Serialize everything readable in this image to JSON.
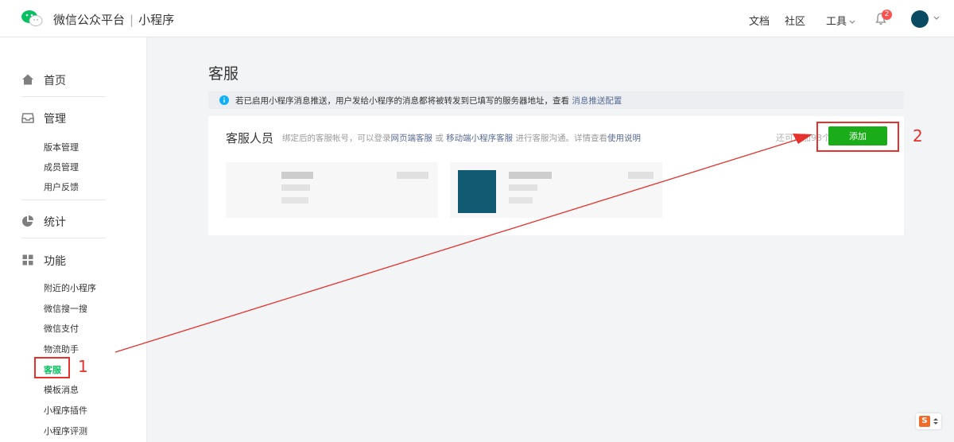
{
  "header": {
    "brand": "微信公众平台",
    "separator": "|",
    "product": "小程序",
    "nav": [
      "文档",
      "社区",
      "工具"
    ],
    "notification_count": "2",
    "tools_caret_icon": "chevron-down-icon",
    "logo_icon": "wechat-logo-icon",
    "bell_icon": "bell-icon"
  },
  "sidebar": {
    "groups": [
      {
        "label": "首页",
        "icon": "home-icon"
      },
      {
        "label": "管理",
        "icon": "inbox-icon",
        "items": [
          "版本管理",
          "成员管理",
          "用户反馈"
        ]
      },
      {
        "label": "统计",
        "icon": "pie-chart-icon"
      },
      {
        "label": "功能",
        "icon": "grid-icon",
        "items": [
          "附近的小程序",
          "微信搜一搜",
          "微信支付",
          "物流助手",
          "客服",
          "模板消息",
          "小程序插件",
          "小程序评测"
        ]
      }
    ],
    "active_item": "客服"
  },
  "main": {
    "title": "客服",
    "notice": {
      "text": "若已启用小程序消息推送，用户发给小程序的消息都将被转发到已填写的服务器地址，查看 ",
      "link": "消息推送配置"
    },
    "card": {
      "title": "客服人员",
      "desc_prefix": "绑定后的客服帐号，可以登录",
      "link_web": "网页端客服",
      "desc_or": " 或 ",
      "link_mobile": "移动端小程序客服",
      "desc_middle": " 进行客服沟通。详情查看",
      "link_help": "使用说明",
      "remain": "还可添加98个",
      "add_button": "添加"
    }
  },
  "annotations": {
    "step1": "1",
    "step2": "2",
    "color": "#e5322d"
  },
  "colors": {
    "accent": "#07c160",
    "button": "#1aad19",
    "link": "#576b95"
  },
  "widget": {
    "label": "S"
  }
}
